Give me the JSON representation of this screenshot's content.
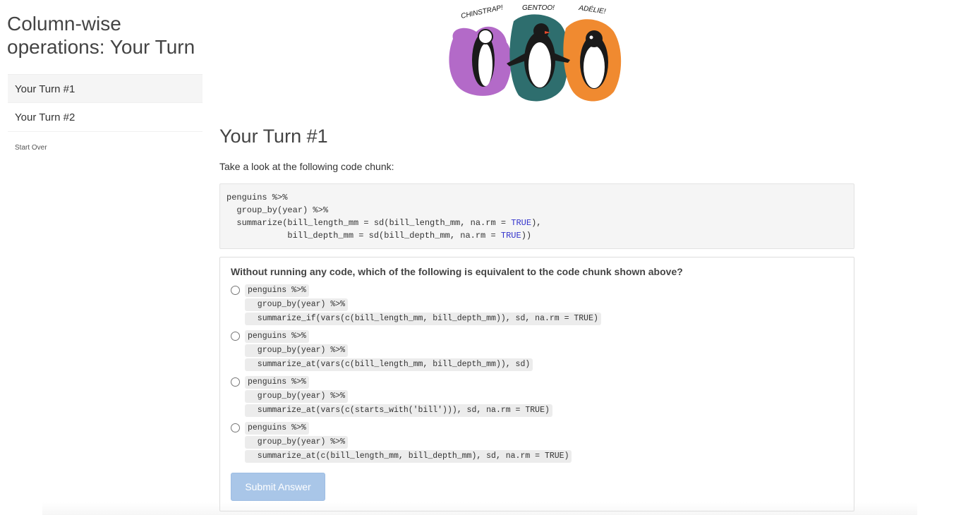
{
  "sidebar": {
    "title": "Column-wise operations: Your Turn",
    "items": [
      {
        "label": "Your Turn #1"
      },
      {
        "label": "Your Turn #2"
      }
    ],
    "start_over": "Start Over"
  },
  "hero": {
    "labels": [
      "CHINSTRAP!",
      "GENTOO!",
      "ADÉLIE!"
    ]
  },
  "main": {
    "section_title": "Your Turn #1",
    "intro": "Take a look at the following code chunk:",
    "code": {
      "line1": "penguins %>%",
      "line2": "  group_by(year) %>%",
      "line3a": "  summarize(bill_length_mm = sd(bill_length_mm, na.rm = ",
      "line3kw": "TRUE",
      "line3b": "),",
      "line4a": "            bill_depth_mm = sd(bill_depth_mm, na.rm = ",
      "line4kw": "TRUE",
      "line4b": "))"
    },
    "quiz": {
      "question": "Without running any code, which of the following is equivalent to the code chunk shown above?",
      "options": [
        {
          "line1": "penguins %>%",
          "line2": "  group_by(year) %>%",
          "line3": "  summarize_if(vars(c(bill_length_mm, bill_depth_mm)), sd, na.rm = TRUE)"
        },
        {
          "line1": "penguins %>%",
          "line2": "  group_by(year) %>%",
          "line3": "  summarize_at(vars(c(bill_length_mm, bill_depth_mm)), sd)"
        },
        {
          "line1": "penguins %>%",
          "line2": "  group_by(year) %>%",
          "line3": "  summarize_at(vars(c(starts_with('bill'))), sd, na.rm = TRUE)"
        },
        {
          "line1": "penguins %>%",
          "line2": "  group_by(year) %>%",
          "line3": "  summarize_at(c(bill_length_mm, bill_depth_mm), sd, na.rm = TRUE)"
        }
      ],
      "submit_label": "Submit Answer"
    }
  },
  "colors": {
    "chinstrap": "#b36ac8",
    "gentoo": "#2e6e6e",
    "adelie": "#f08a30",
    "submit_disabled": "#a9c6e8",
    "keyword": "#3333cc"
  }
}
